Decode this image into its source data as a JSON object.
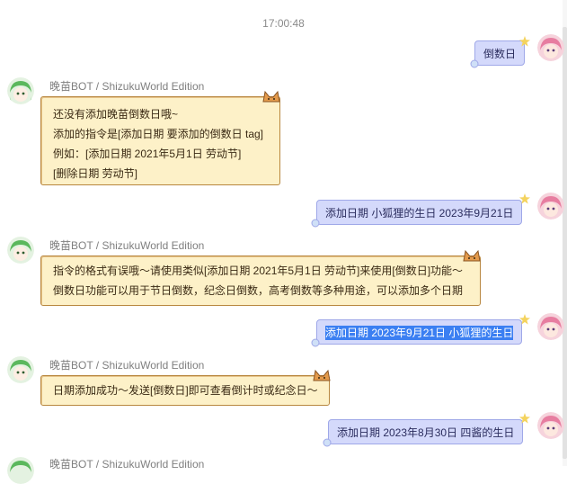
{
  "chat": {
    "timestamp": "17:00:48",
    "bot_name": "晚苗BOT / ShizukuWorld Edition",
    "messages": [
      {
        "from": "user",
        "text": "倒数日"
      },
      {
        "from": "bot",
        "lines": [
          "还没有添加晚苗倒数日哦~",
          "添加的指令是[添加日期 要添加的倒数日 tag]",
          "例如：[添加日期 2021年5月1日 劳动节]",
          "[删除日期 劳动节]"
        ]
      },
      {
        "from": "user",
        "text": "添加日期 小狐狸的生日 2023年9月21日"
      },
      {
        "from": "bot",
        "lines": [
          "指令的格式有误哦～请使用类似[添加日期 2021年5月1日 劳动节]来使用[倒数日]功能～",
          "倒数日功能可以用于节日倒数，纪念日倒数，高考倒数等多种用途，可以添加多个日期"
        ]
      },
      {
        "from": "user",
        "text": "添加日期 2023年9月21日 小狐狸的生日",
        "selected": true
      },
      {
        "from": "bot",
        "lines": [
          "日期添加成功～发送[倒数日]即可查看倒计时或纪念日～"
        ]
      },
      {
        "from": "user",
        "text": "添加日期 2023年8月30日 四酱的生日"
      }
    ]
  },
  "colors": {
    "bot_bubble_bg": "#fdf1c8",
    "bot_bubble_border": "#b8873f",
    "user_bubble_bg": "#d4d9fb",
    "user_bubble_border": "#9fa8e8",
    "selection": "#3b7ff2"
  },
  "icons": {
    "bot_avatar": "green-haired-girl-avatar",
    "user_avatar": "pink-haired-girl-avatar",
    "bot_bubble_decoration": "cat-ears-icon",
    "user_bubble_decoration": "star-icon"
  }
}
